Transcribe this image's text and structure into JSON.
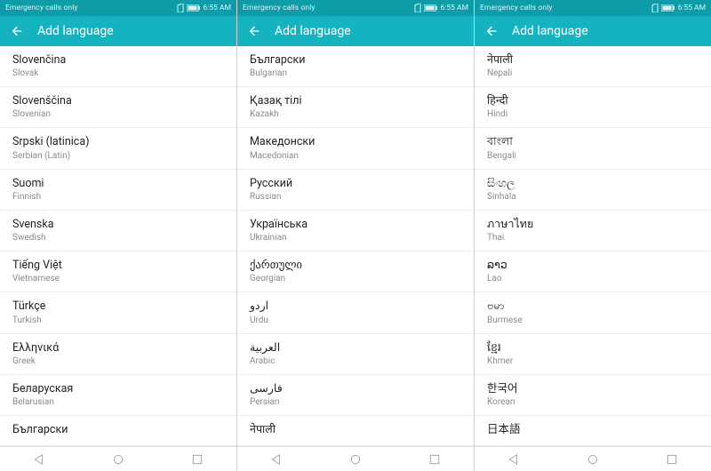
{
  "status": {
    "left": "Emergency calls only",
    "time": "6:55 AM"
  },
  "titlebar": {
    "title": "Add language"
  },
  "panels": [
    {
      "items": [
        {
          "native": "Slovenčina",
          "english": "Slovak"
        },
        {
          "native": "Slovenščina",
          "english": "Slovenian"
        },
        {
          "native": "Srpski (latinica)",
          "english": "Serbian (Latin)"
        },
        {
          "native": "Suomi",
          "english": "Finnish"
        },
        {
          "native": "Svenska",
          "english": "Swedish"
        },
        {
          "native": "Tiếng Việt",
          "english": "Vietnamese"
        },
        {
          "native": "Türkçe",
          "english": "Turkish"
        },
        {
          "native": "Ελληνικά",
          "english": "Greek"
        },
        {
          "native": "Беларуская",
          "english": "Belarusian"
        },
        {
          "native": "Български",
          "english": ""
        }
      ]
    },
    {
      "items": [
        {
          "native": "Български",
          "english": "Bulgarian"
        },
        {
          "native": "Қазақ тілі",
          "english": "Kazakh"
        },
        {
          "native": "Македонски",
          "english": "Macedonian"
        },
        {
          "native": "Русский",
          "english": "Russian"
        },
        {
          "native": "Українська",
          "english": "Ukrainian"
        },
        {
          "native": "ქართული",
          "english": "Georgian"
        },
        {
          "native": "اردو",
          "english": "Urdu"
        },
        {
          "native": "العربية",
          "english": "Arabic"
        },
        {
          "native": "فارسی",
          "english": "Persian"
        },
        {
          "native": "नेपाली",
          "english": ""
        }
      ]
    },
    {
      "items": [
        {
          "native": "नेपाली",
          "english": "Nepali"
        },
        {
          "native": "हिन्दी",
          "english": "Hindi"
        },
        {
          "native": "বাংলা",
          "english": "Bengali"
        },
        {
          "native": "සිංහල",
          "english": "Sinhala"
        },
        {
          "native": "ภาษาไทย",
          "english": "Thai"
        },
        {
          "native": "ລາວ",
          "english": "Lao"
        },
        {
          "native": "ဗမာ",
          "english": "Burmese"
        },
        {
          "native": "ខ្មែរ",
          "english": "Khmer"
        },
        {
          "native": "한국어",
          "english": "Korean"
        },
        {
          "native": "日本語",
          "english": ""
        }
      ]
    }
  ]
}
